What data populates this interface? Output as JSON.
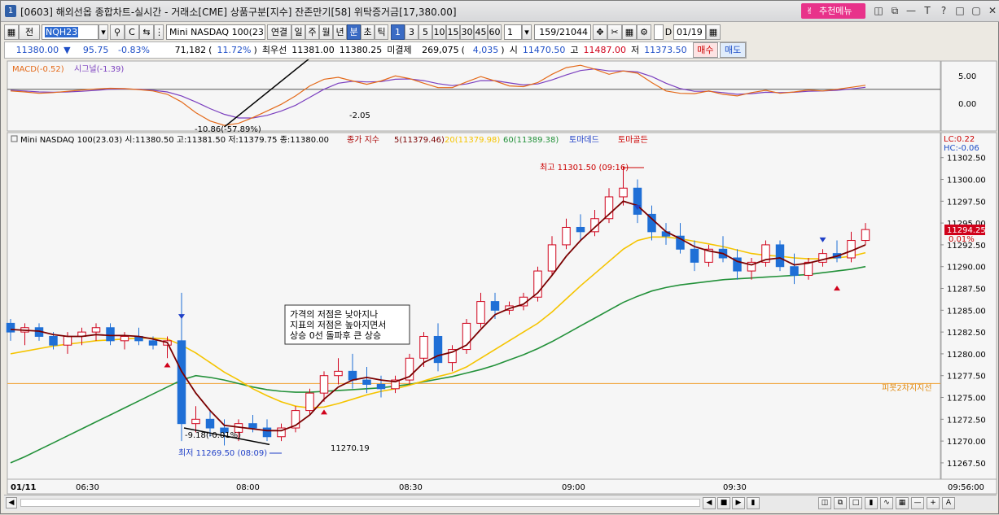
{
  "titlebar": {
    "window_number": "1",
    "title": "[0603] 해외선옵 종합차트-실시간 - 거래소[CME] 상품구분[지수] 잔존만기[58] 위탁증거금[17,380.00]",
    "recommend_label": "추천메뉴",
    "icons": [
      "split-icon",
      "copy-icon",
      "minimize-icon",
      "font-icon",
      "help-icon",
      "restore-icon",
      "maximize-icon",
      "close-icon"
    ]
  },
  "toolbar": {
    "all_label": "전",
    "code_value": "NQH23",
    "product_name": "Mini NASDAQ 100(23.0",
    "period_buttons": [
      "연결",
      "일",
      "주",
      "월",
      "년",
      "분",
      "초",
      "틱"
    ],
    "selected_period": "분",
    "interval_buttons": [
      "1",
      "3",
      "5",
      "10",
      "15",
      "30",
      "45",
      "60"
    ],
    "selected_interval": "1",
    "count_value": "1",
    "range_value": "159/21044",
    "d_label": "D",
    "date_value": "01/19"
  },
  "quote": {
    "price": "11380.00",
    "change": "95.75",
    "change_pct": "-0.83%",
    "volume": "71,182",
    "volume_ratio": "11.72%",
    "bid_label": "최우선",
    "bid": "11381.00",
    "ask": "11380.25",
    "open_interest_label": "미결제",
    "open_interest": "269,075",
    "oi_change": "4,035",
    "open_label": "시",
    "open": "11470.50",
    "high_label": "고",
    "high": "11487.00",
    "low_label": "저",
    "low": "11373.50",
    "buy_label": "매수",
    "sell_label": "매도"
  },
  "macd_panel": {
    "legend_macd": "MACD(-0.52)",
    "legend_signal": "시그널(-1.39)",
    "label_low": "-10.86(-57.89%)",
    "label_end": "-2.05",
    "y_ticks": [
      "5.00",
      "0.00"
    ]
  },
  "price_panel": {
    "legend": "Mini NASDAQ 100(23.03) 시:11380.50 고:11381.50 저:11379.75 종:11380.00",
    "ma_label": "종가 지수",
    "ma5": "5(11379.46)",
    "ma20": "20(11379.98)",
    "ma60": "60(11389.38)",
    "tomadead": "토마데드",
    "tomagold": "토마골든",
    "lc": "LC:0.22",
    "hc": "HC:-0.06",
    "annotation_lines": [
      "가격의 저점은 낮아지나",
      "지표의 저점은 높아지면서",
      "상승 0선 돌파후 큰 상승"
    ],
    "high_note": "최고 11301.50 (09:16)",
    "low_note": "최저 11269.50 (08:09)",
    "low_change": "-9.18(-0.01%)",
    "low_right": "11270.19",
    "pivot_label": "피봇2차지지선",
    "current_price": "11294.25",
    "current_pct": "0.01%",
    "y_ticks": [
      "11302.50",
      "11300.00",
      "11297.50",
      "11295.00",
      "11292.50",
      "11290.00",
      "11287.50",
      "11285.00",
      "11282.50",
      "11280.00",
      "11277.50",
      "11275.00",
      "11272.50",
      "11270.00",
      "11267.50"
    ]
  },
  "time_axis": {
    "date": "01/11",
    "ticks": [
      "06:30",
      "08:00",
      "08:30",
      "09:00",
      "09:30"
    ],
    "end": "09:56:00"
  },
  "colors": {
    "candle_up": "#d0021b",
    "candle_down": "#1f6fd6",
    "ma5": "#7a0000",
    "ma20": "#f5c400",
    "ma60": "#23913a",
    "macd": "#e46a1a",
    "signal": "#7b3fbf",
    "pivot": "#f0a030",
    "recommend": "#e8328a"
  },
  "chart_data": {
    "type": "candlestick",
    "macd_ylim": [
      -12,
      7
    ],
    "price_ylim": [
      11266.0,
      11303.5
    ],
    "pivot_support": 11276.6,
    "macd": [
      -0.5,
      -0.8,
      -1.2,
      -1.0,
      -0.6,
      -0.2,
      0.1,
      0.3,
      0.2,
      -0.1,
      -0.5,
      -1.5,
      -3.8,
      -7.0,
      -9.5,
      -10.8,
      -10.2,
      -8.5,
      -6.5,
      -4.5,
      -2.0,
      1.0,
      3.0,
      3.6,
      2.5,
      1.5,
      2.5,
      4.0,
      3.2,
      1.8,
      0.5,
      0.5,
      2.2,
      3.8,
      2.5,
      1.0,
      0.8,
      2.0,
      4.5,
      6.5,
      7.2,
      6.0,
      4.5,
      5.5,
      4.8,
      2.0,
      -0.5,
      -1.2,
      -1.3,
      -0.5,
      -1.5,
      -2.0,
      -1.0,
      -0.3,
      -1.2,
      -0.8,
      -0.2,
      -0.5,
      0.0,
      0.6,
      1.2
    ],
    "signal": [
      -0.3,
      -0.5,
      -0.8,
      -0.9,
      -0.8,
      -0.6,
      -0.3,
      0.0,
      0.1,
      0.0,
      -0.3,
      -0.8,
      -2.0,
      -3.8,
      -5.8,
      -7.5,
      -8.6,
      -8.6,
      -7.8,
      -6.5,
      -4.8,
      -2.4,
      0.0,
      1.8,
      2.4,
      2.2,
      2.3,
      3.0,
      3.1,
      2.6,
      1.7,
      1.1,
      1.6,
      2.6,
      2.6,
      1.9,
      1.3,
      1.6,
      2.8,
      4.3,
      5.6,
      6.1,
      5.5,
      5.5,
      5.2,
      3.8,
      1.8,
      0.2,
      -0.6,
      -0.6,
      -1.0,
      -1.5,
      -1.3,
      -0.9,
      -1.0,
      -0.9,
      -0.6,
      -0.5,
      -0.3,
      0.1,
      0.6
    ],
    "ohlc": [
      [
        11283.5,
        11284.0,
        11281.5,
        11282.5
      ],
      [
        11282.5,
        11283.5,
        11281.0,
        11283.0
      ],
      [
        11283.0,
        11283.5,
        11281.5,
        11282.0
      ],
      [
        11282.0,
        11282.5,
        11280.5,
        11281.0
      ],
      [
        11281.0,
        11282.5,
        11280.0,
        11282.0
      ],
      [
        11282.0,
        11283.0,
        11281.0,
        11282.5
      ],
      [
        11282.5,
        11283.5,
        11281.5,
        11283.0
      ],
      [
        11283.0,
        11283.5,
        11281.0,
        11281.5
      ],
      [
        11281.5,
        11282.5,
        11280.5,
        11282.0
      ],
      [
        11282.0,
        11283.0,
        11281.0,
        11281.5
      ],
      [
        11281.5,
        11282.0,
        11280.5,
        11281.0
      ],
      [
        11281.0,
        11282.0,
        11279.5,
        11281.5
      ],
      [
        11281.5,
        11287.0,
        11270.0,
        11272.0
      ],
      [
        11272.0,
        11274.0,
        11271.0,
        11272.5
      ],
      [
        11272.5,
        11273.5,
        11270.5,
        11271.5
      ],
      [
        11271.5,
        11272.5,
        11269.5,
        11271.0
      ],
      [
        11271.0,
        11272.5,
        11270.0,
        11272.0
      ],
      [
        11272.0,
        11273.0,
        11271.0,
        11271.5
      ],
      [
        11271.5,
        11272.5,
        11270.0,
        11270.5
      ],
      [
        11270.5,
        11272.0,
        11270.0,
        11271.5
      ],
      [
        11271.5,
        11274.0,
        11271.0,
        11273.5
      ],
      [
        11273.5,
        11276.0,
        11273.0,
        11275.5
      ],
      [
        11275.5,
        11278.0,
        11274.5,
        11277.5
      ],
      [
        11277.5,
        11279.5,
        11276.5,
        11278.0
      ],
      [
        11278.0,
        11280.0,
        11276.0,
        11277.0
      ],
      [
        11277.0,
        11278.5,
        11275.5,
        11276.5
      ],
      [
        11276.5,
        11277.5,
        11275.0,
        11276.0
      ],
      [
        11276.0,
        11277.5,
        11275.5,
        11277.0
      ],
      [
        11277.0,
        11280.0,
        11276.5,
        11279.5
      ],
      [
        11279.5,
        11282.5,
        11278.5,
        11282.0
      ],
      [
        11282.0,
        11283.5,
        11278.0,
        11279.0
      ],
      [
        11279.0,
        11281.0,
        11278.0,
        11280.5
      ],
      [
        11280.5,
        11284.0,
        11280.0,
        11283.5
      ],
      [
        11283.5,
        11287.0,
        11283.0,
        11286.0
      ],
      [
        11286.0,
        11287.0,
        11284.0,
        11285.0
      ],
      [
        11285.0,
        11286.0,
        11284.5,
        11285.5
      ],
      [
        11285.5,
        11287.0,
        11285.0,
        11286.5
      ],
      [
        11286.5,
        11290.0,
        11286.0,
        11289.5
      ],
      [
        11289.5,
        11293.5,
        11289.0,
        11292.5
      ],
      [
        11292.5,
        11295.5,
        11292.0,
        11294.5
      ],
      [
        11294.5,
        11296.0,
        11293.0,
        11294.0
      ],
      [
        11294.0,
        11296.5,
        11293.5,
        11295.5
      ],
      [
        11295.5,
        11299.0,
        11295.0,
        11298.0
      ],
      [
        11298.0,
        11301.5,
        11297.0,
        11299.0
      ],
      [
        11299.0,
        11300.0,
        11295.0,
        11296.0
      ],
      [
        11296.0,
        11297.0,
        11293.0,
        11294.0
      ],
      [
        11294.0,
        11295.0,
        11292.5,
        11293.5
      ],
      [
        11293.5,
        11295.0,
        11291.5,
        11292.0
      ],
      [
        11292.0,
        11293.0,
        11289.5,
        11290.5
      ],
      [
        11290.5,
        11292.5,
        11290.0,
        11292.0
      ],
      [
        11292.0,
        11293.5,
        11290.5,
        11291.0
      ],
      [
        11291.0,
        11292.0,
        11288.5,
        11289.5
      ],
      [
        11289.5,
        11291.0,
        11288.5,
        11290.5
      ],
      [
        11290.5,
        11293.0,
        11290.0,
        11292.5
      ],
      [
        11292.5,
        11293.0,
        11289.5,
        11290.0
      ],
      [
        11290.0,
        11291.5,
        11288.0,
        11289.0
      ],
      [
        11289.0,
        11291.0,
        11288.5,
        11290.5
      ],
      [
        11290.5,
        11292.0,
        11290.0,
        11291.5
      ],
      [
        11291.5,
        11293.0,
        11290.5,
        11291.0
      ],
      [
        11291.0,
        11294.0,
        11290.5,
        11293.0
      ],
      [
        11293.0,
        11295.0,
        11292.5,
        11294.25
      ]
    ],
    "ma5": [
      11282.8,
      11282.7,
      11282.6,
      11282.2,
      11282.0,
      11282.0,
      11282.2,
      11282.1,
      11282.1,
      11282.0,
      11281.7,
      11281.3,
      11278.0,
      11275.5,
      11273.5,
      11271.8,
      11271.6,
      11271.4,
      11271.2,
      11271.2,
      11271.8,
      11273.0,
      11274.8,
      11276.2,
      11277.0,
      11277.3,
      11277.0,
      11276.8,
      11277.4,
      11279.0,
      11279.8,
      11280.2,
      11281.0,
      11282.8,
      11284.5,
      11285.2,
      11285.7,
      11287.0,
      11289.0,
      11291.2,
      11293.0,
      11294.5,
      11296.0,
      11297.5,
      11297.0,
      11295.5,
      11294.0,
      11293.2,
      11292.3,
      11291.8,
      11291.5,
      11290.6,
      11290.2,
      11290.8,
      11291.0,
      11290.2,
      11290.4,
      11290.8,
      11291.2,
      11291.8,
      11292.5
    ],
    "ma20": [
      11280.0,
      11280.3,
      11280.6,
      11280.9,
      11281.1,
      11281.3,
      11281.5,
      11281.6,
      11281.7,
      11281.8,
      11281.8,
      11281.7,
      11281.0,
      11280.1,
      11279.0,
      11277.9,
      11277.0,
      11276.0,
      11275.2,
      11274.5,
      11274.0,
      11273.8,
      11273.9,
      11274.3,
      11274.8,
      11275.3,
      11275.7,
      11276.0,
      11276.4,
      11276.9,
      11277.4,
      11277.8,
      11278.5,
      11279.5,
      11280.5,
      11281.5,
      11282.5,
      11283.5,
      11284.8,
      11286.3,
      11287.8,
      11289.2,
      11290.6,
      11292.0,
      11293.0,
      11293.4,
      11293.4,
      11293.2,
      11292.9,
      11292.6,
      11292.3,
      11291.9,
      11291.5,
      11291.3,
      11291.2,
      11291.0,
      11290.9,
      11290.9,
      11291.0,
      11291.2,
      11291.6
    ],
    "ma60": [
      11267.5,
      11268.2,
      11269.0,
      11269.8,
      11270.6,
      11271.4,
      11272.2,
      11273.0,
      11273.8,
      11274.6,
      11275.4,
      11276.2,
      11277.0,
      11277.5,
      11277.3,
      11277.0,
      11276.6,
      11276.2,
      11275.9,
      11275.7,
      11275.6,
      11275.6,
      11275.7,
      11275.8,
      11275.9,
      11276.0,
      11276.1,
      11276.3,
      11276.5,
      11276.8,
      11277.1,
      11277.4,
      11277.8,
      11278.2,
      11278.7,
      11279.3,
      11279.9,
      11280.6,
      11281.4,
      11282.3,
      11283.2,
      11284.1,
      11285.0,
      11285.9,
      11286.6,
      11287.2,
      11287.6,
      11287.9,
      11288.1,
      11288.3,
      11288.5,
      11288.6,
      11288.7,
      11288.8,
      11288.9,
      11289.0,
      11289.1,
      11289.3,
      11289.5,
      11289.7,
      11290.0
    ]
  }
}
